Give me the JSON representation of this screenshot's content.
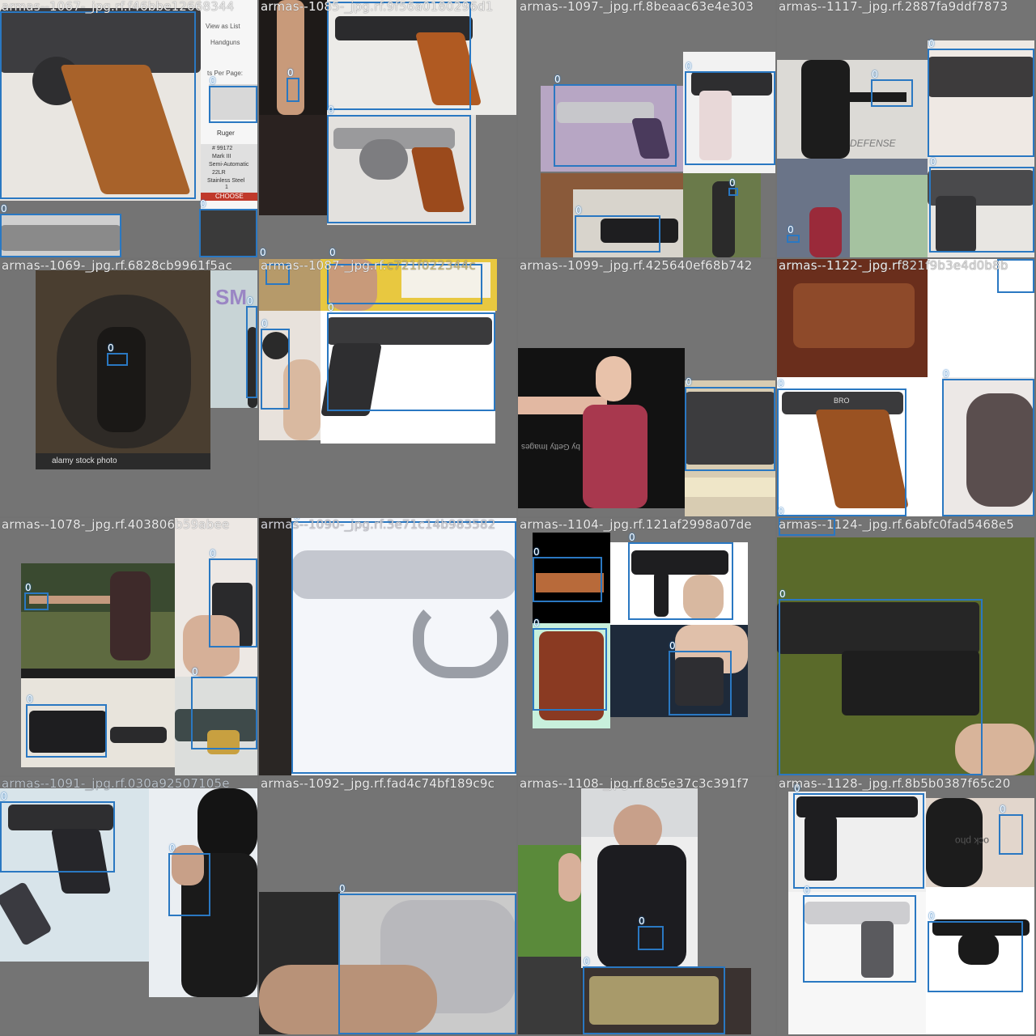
{
  "tiles": [
    {
      "title": "armas--1067-_jpg.rf.f46bbe12668344",
      "labels": [
        "0",
        "0",
        "0"
      ],
      "texts": {
        "a": "View as List",
        "b": "Handguns",
        "c": "ts Per Page:",
        "d": "24",
        "e": "Ruger",
        "f": "# 99172",
        "g": "Mark III",
        "h": "Semi-Automatic",
        "i": "22LR",
        "j": "Stainless Steel",
        "k": "1",
        "l": "CHOOSE"
      }
    },
    {
      "title": "armas--1085-_jpg.rf.9f56a0180296d1",
      "labels": [
        "0",
        "0",
        "0",
        "0",
        "0"
      ]
    },
    {
      "title": "armas--1097-_jpg.rf.8beaac63e4e303",
      "labels": [
        "0",
        "0",
        "0",
        "0"
      ]
    },
    {
      "title": "armas--1117-_jpg.rf.2887fa9ddf7873",
      "labels": [
        "0",
        "0",
        "0",
        "0",
        "0"
      ],
      "texts": {
        "a": "DEFENSE"
      }
    },
    {
      "title": "armas--1069-_jpg.rf.6828cb9961f5ac",
      "labels": [
        "0",
        "0"
      ],
      "texts": {
        "a": "alamy stock photo",
        "b": "SM"
      }
    },
    {
      "title": "armas--1087-_jpg.rf.",
      "title_tail": "c721f022344c",
      "labels": [
        "0",
        "0",
        "0",
        "0"
      ]
    },
    {
      "title": "armas--1099-_jpg.rf.425640ef68b742",
      "labels": [
        "0",
        "0"
      ],
      "texts": {
        "a": "by Getty Images"
      }
    },
    {
      "title": "armas--1122-_jpg.rf",
      "title_tail": "821f9b3e4d0b8b",
      "labels": [
        "0",
        "0",
        "0"
      ],
      "texts": {
        "a": "BRO"
      }
    },
    {
      "title": "armas--1078-_jpg.rf.403806b59abee",
      "labels": [
        "0",
        "0",
        "0",
        "0"
      ]
    },
    {
      "title": "armas--1090-_jpg.rf.3e71c14b983582",
      "labels": [
        "0"
      ]
    },
    {
      "title": "armas--1104-_jpg.rf.121af2998a07de",
      "labels": [
        "0",
        "0",
        "0",
        "0",
        "0"
      ]
    },
    {
      "title": "armas--1124-_jpg.rf.6abfc0fad5468e5",
      "labels": [
        "0",
        "0"
      ]
    },
    {
      "title": "armas--1091-_jpg.rf.030a92507105e",
      "labels": [
        "0",
        "0"
      ]
    },
    {
      "title": "armas--1092-_jpg.rf.fad4c74bf189c9c",
      "labels": [
        "0"
      ]
    },
    {
      "title": "armas--1108-_jpg.rf.8c5e37c3c391f7",
      "labels": [
        "0",
        "0"
      ]
    },
    {
      "title": "armas--1128-_jpg.rf.8b5b0387f65c20",
      "labels": [
        "0",
        "0",
        "0",
        "0"
      ],
      "texts": {
        "a": "ock pho"
      }
    }
  ],
  "colors": {
    "box": "#2a78c2",
    "pad": "#747474",
    "label_text": "#ffffff"
  }
}
